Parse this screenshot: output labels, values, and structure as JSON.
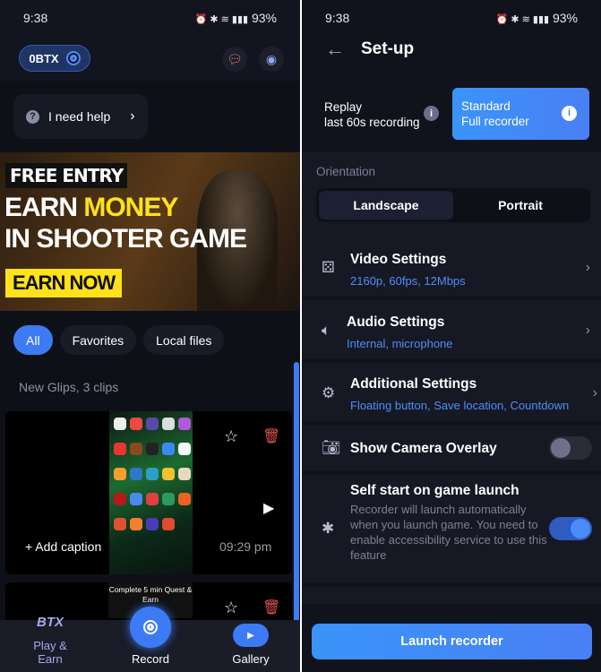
{
  "status": {
    "time": "9:38",
    "icons": "⏰ ✱ ≋ ▮▮▮",
    "battery": "93%"
  },
  "left": {
    "balance": "0BTX",
    "help": "I need help",
    "banner": {
      "line1": "FREE ENTRY",
      "line2a": "EARN ",
      "line2b": "MONEY",
      "line3": "IN SHOOTER GAME",
      "cta": "EARN NOW"
    },
    "chips": [
      "All",
      "Favorites",
      "Local files"
    ],
    "section": "New Glips, 3 clips",
    "clip": {
      "caption": "+ Add caption",
      "time": "09:29 pm"
    },
    "quest": "Complete 5 min Quest & Earn",
    "nav": {
      "logo": "BTX",
      "play": "Play & Earn",
      "record": "Record",
      "gallery": "Gallery"
    },
    "colors": {
      "accent": "#3d7bf5",
      "delete": "#e0524f"
    }
  },
  "right": {
    "title": "Set-up",
    "replay": {
      "line1": "Replay",
      "line2": "last 60s recording"
    },
    "standard": {
      "line1": "Standard",
      "line2": "Full recorder"
    },
    "orientation": {
      "label": "Orientation",
      "options": [
        "Landscape",
        "Portrait"
      ],
      "selected": "Landscape"
    },
    "settings": [
      {
        "title": "Video Settings",
        "sub": "2160p, 60fps, 12Mbps"
      },
      {
        "title": "Audio Settings",
        "sub": "Internal, microphone"
      },
      {
        "title": "Additional Settings",
        "sub": "Floating button, Save location, Countdown"
      }
    ],
    "camera": {
      "title": "Show Camera Overlay",
      "on": false
    },
    "selfstart": {
      "title": "Self start on game launch",
      "desc": "Recorder will launch automatically when you launch game. You need to enable accessibility service to use this feature",
      "on": true
    },
    "launch": "Launch recorder"
  }
}
